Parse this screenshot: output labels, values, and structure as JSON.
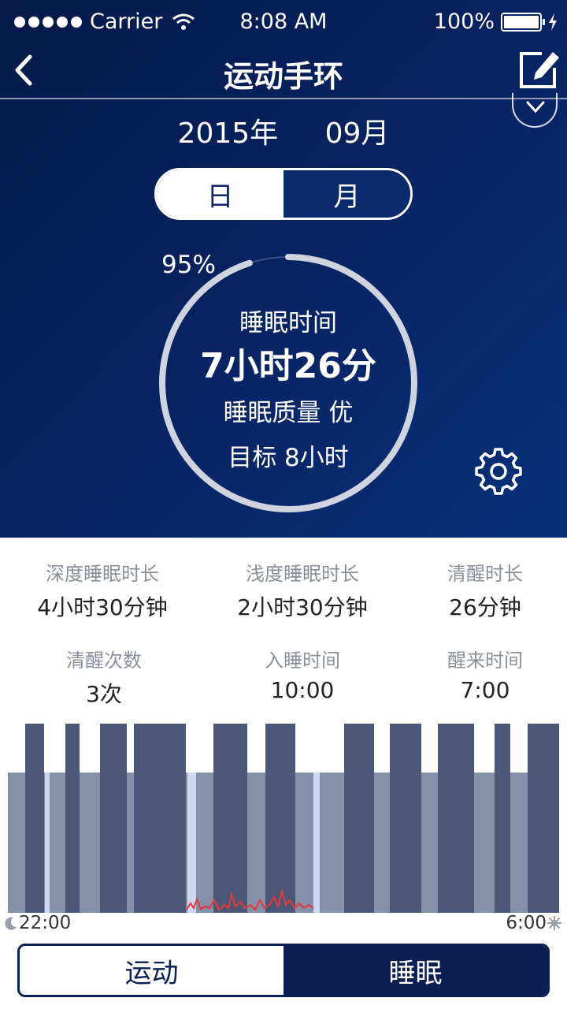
{
  "status_bar": {
    "carrier": "Carrier",
    "time": "8:08 AM",
    "battery": "100%"
  },
  "nav": {
    "title": "运动手环"
  },
  "date": {
    "year": "2015年",
    "month": "09月"
  },
  "segment": {
    "day": "日",
    "month": "月",
    "selected": "月"
  },
  "ring": {
    "percent_label": "95%",
    "progress": 0.95,
    "title": "睡眠时间",
    "duration": "7小时26分",
    "quality": "睡眠质量  优",
    "goal": "目标  8小时"
  },
  "stats": [
    {
      "label": "深度睡眠时长",
      "value": "4小时30分钟"
    },
    {
      "label": "浅度睡眠时长",
      "value": "2小时30分钟"
    },
    {
      "label": "清醒时长",
      "value": "26分钟"
    },
    {
      "label": "清醒次数",
      "value": "3次"
    },
    {
      "label": "入睡时间",
      "value": "10:00"
    },
    {
      "label": "醒来时间",
      "value": "7:00"
    }
  ],
  "chart_data": {
    "type": "bar",
    "x_start": "22:00",
    "x_end": "6:00",
    "colors": {
      "deep": "#4c5778",
      "light": "#858fa8",
      "awake": "#ccd7f2",
      "heart": "#e23838"
    }
  },
  "tabs": {
    "sport": "运动",
    "sleep": "睡眠",
    "selected": "睡眠"
  },
  "icons": [
    "wifi-icon",
    "bolt-icon",
    "back-icon",
    "edit-icon",
    "chevron-down-icon",
    "gear-icon",
    "moon-icon",
    "sun-icon"
  ]
}
